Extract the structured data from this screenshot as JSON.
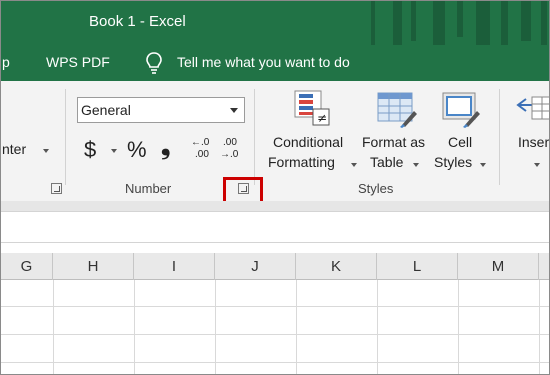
{
  "window": {
    "title": "Book 1  -  Excel"
  },
  "menu": {
    "partial_item": "p",
    "wps_pdf": "WPS PDF",
    "tell_me": "Tell me what you want to do",
    "tell_me_icon": "lightbulb-icon"
  },
  "ribbon": {
    "alignment": {
      "merge_center_partial": "nter"
    },
    "number": {
      "format_value": "General",
      "currency_symbol": "$",
      "percent_symbol": "%",
      "comma_symbol": "❟",
      "increase_decimal_top": "←.0",
      "increase_decimal_bottom": ".00",
      "decrease_decimal_top": ".00",
      "decrease_decimal_bottom": "→.0",
      "group_label": "Number"
    },
    "styles": {
      "conditional_formatting_line1": "Conditional",
      "conditional_formatting_line2": "Formatting",
      "format_as_table_line1": "Format as",
      "format_as_table_line2": "Table",
      "cell_styles_line1": "Cell",
      "cell_styles_line2": "Styles",
      "group_label": "Styles"
    },
    "cells": {
      "insert_partial": "Inser"
    }
  },
  "sheet": {
    "columns": [
      "G",
      "H",
      "I",
      "J",
      "K",
      "L",
      "M"
    ]
  },
  "colors": {
    "title_bar": "#217346",
    "highlight": "#cc0000"
  }
}
